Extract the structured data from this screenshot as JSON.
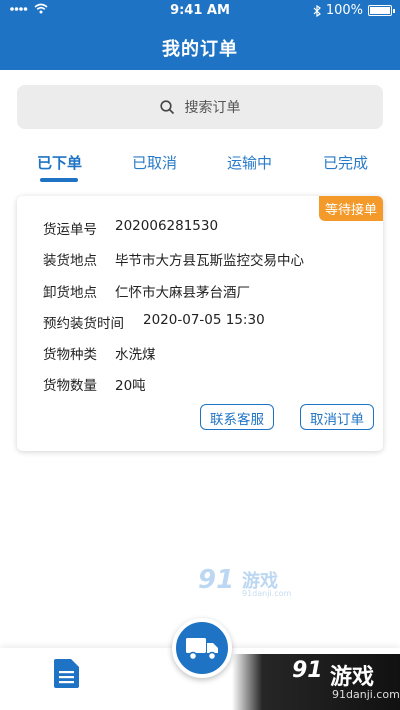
{
  "status_bar": {
    "time": "9:41 AM",
    "battery": "100%",
    "battery_fraction": 1.0
  },
  "header": {
    "title": "我的订单"
  },
  "search": {
    "placeholder": "搜索订单"
  },
  "tabs": [
    {
      "label": "已下单",
      "active": true
    },
    {
      "label": "已取消",
      "active": false
    },
    {
      "label": "运输中",
      "active": false
    },
    {
      "label": "已完成",
      "active": false
    }
  ],
  "order": {
    "status_badge": "等待接单",
    "fields": [
      {
        "label": "货运单号",
        "value": "202006281530"
      },
      {
        "label": "装货地点",
        "value": "毕节市大方县瓦斯监控交易中心"
      },
      {
        "label": "卸货地点",
        "value": "仁怀市大麻县茅台酒厂"
      },
      {
        "label": "预约装货时间",
        "value": "2020-07-05 15:30"
      },
      {
        "label": "货物种类",
        "value": "水洗煤"
      },
      {
        "label": "货物数量",
        "value": "20吨"
      }
    ],
    "buttons": {
      "contact": "联系客服",
      "cancel": "取消订单"
    }
  },
  "watermark": {
    "brand_num": "91",
    "brand_text": "游戏",
    "domain": "91danji.com"
  },
  "corner_logo": {
    "brand_num": "91",
    "brand_text": "游戏",
    "domain": "91danji.com"
  },
  "colors": {
    "primary": "#1f73c4",
    "badge": "#f39a2b"
  }
}
